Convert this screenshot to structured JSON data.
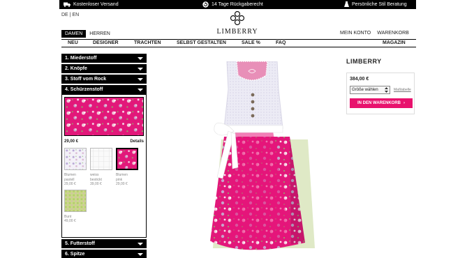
{
  "topbar": {
    "shipping": "Kostenloser Versand",
    "returns": "14 Tage Rückgaberecht",
    "consulting": "Persönliche Stil Beratung"
  },
  "lang": {
    "de": "DE",
    "sep": "|",
    "en": "EN"
  },
  "logo": {
    "name": "LIMBERRY"
  },
  "gender": {
    "women": "DAMEN",
    "men": "HERREN"
  },
  "account": {
    "my_account": "MEIN KONTO",
    "cart": "WARENKORB"
  },
  "nav": [
    "NEU",
    "DESIGNER",
    "TRACHTEN",
    "SELBST GESTALTEN",
    "SALE %",
    "FAQ",
    "MAGAZIN"
  ],
  "config": {
    "steps": [
      "1. Miederstoff",
      "2. Knöpfe",
      "3. Stoff vom Rock",
      "4. Schürzenstoff",
      "5. Futterstoff",
      "6. Spitze"
    ],
    "selected_price": "29,00 €",
    "details": "Details",
    "options": [
      {
        "name": "Blumen pastell",
        "line1": "Blumen",
        "line2": "pastell",
        "price": "29,00 €"
      },
      {
        "name": "weiss bestickt",
        "line1": "weiss",
        "line2": "bestickt",
        "price": "39,00 €"
      },
      {
        "name": "Blumen pink",
        "line1": "Blumen",
        "line2": "pink",
        "price": "29,00 €"
      },
      {
        "name": "Bunt",
        "line1": "Bunt",
        "line2": "",
        "price": "49,00 €"
      }
    ]
  },
  "product": {
    "brand": "LIMBERRY",
    "price": "384,00 €",
    "size_select": "Größe wählen",
    "size_table": "Maßtabelle",
    "add_to_cart": "IN DEN WARENKORB",
    "add_to_cart_arrow": "›"
  },
  "colors": {
    "accent": "#e8126d",
    "black": "#000000",
    "apron": "#e8147a",
    "bodice": "#eceaf6"
  }
}
